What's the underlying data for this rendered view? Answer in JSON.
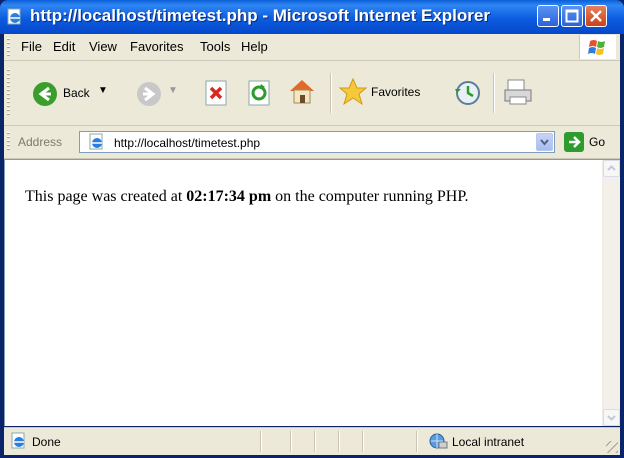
{
  "window": {
    "title": "http://localhost/timetest.php - Microsoft Internet Explorer",
    "controls": [
      "minimize-icon",
      "maximize-icon",
      "close-icon"
    ]
  },
  "menu": {
    "items": [
      "File",
      "Edit",
      "View",
      "Favorites",
      "Tools",
      "Help"
    ]
  },
  "toolbar": {
    "back_label": "Back",
    "favorites_label": "Favorites"
  },
  "address": {
    "label": "Address",
    "url": "http://localhost/timetest.php",
    "go_label": "Go"
  },
  "page": {
    "text_before": "This page was created at ",
    "time": "02:17:34 pm",
    "text_after": " on the computer running PHP."
  },
  "status": {
    "left": "Done",
    "zone": "Local intranet"
  },
  "colors": {
    "titlebar": "#0b5ce0",
    "chrome": "#ece9d8",
    "go_green": "#2e9b2e"
  }
}
